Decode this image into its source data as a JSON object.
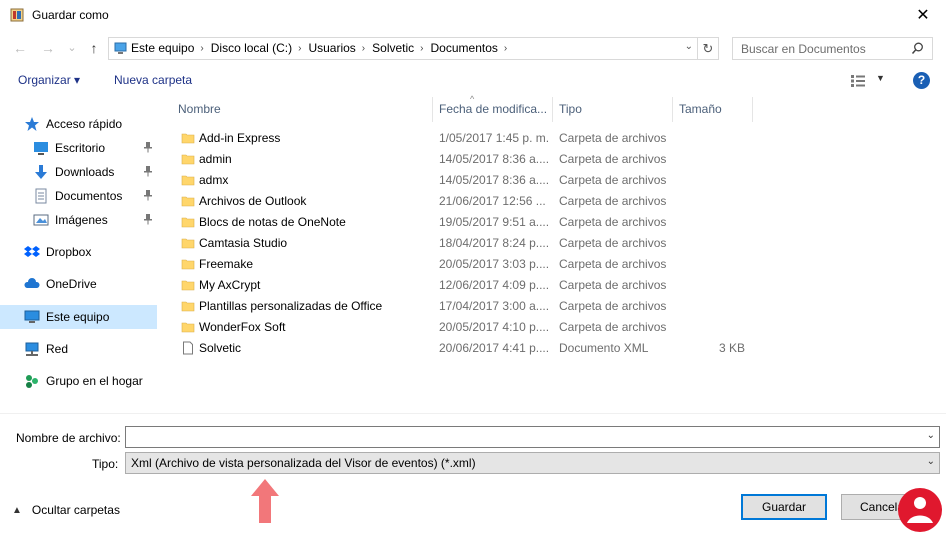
{
  "window": {
    "title": "Guardar como",
    "close_glyph": "✕"
  },
  "navigation": {
    "back_glyph": "←",
    "forward_glyph": "→",
    "recent_glyph": "⌄",
    "up_glyph": "↑",
    "breadcrumbs": [
      "Este equipo",
      "Disco local (C:)",
      "Usuarios",
      "Solvetic",
      "Documentos"
    ],
    "breadcrumb_separator": "›",
    "refresh_glyph": "↻",
    "search_placeholder": "Buscar en Documentos"
  },
  "toolbar": {
    "organize": "Organizar ▾",
    "new_folder": "Nueva carpeta",
    "help": "?"
  },
  "sidebar": {
    "items": [
      {
        "label": "Acceso rápido",
        "icon": "star-icon"
      },
      {
        "label": "Escritorio",
        "icon": "desktop-icon",
        "pinned": true
      },
      {
        "label": "Downloads",
        "icon": "download-icon",
        "pinned": true
      },
      {
        "label": "Documentos",
        "icon": "document-icon",
        "pinned": true
      },
      {
        "label": "Imágenes",
        "icon": "image-icon",
        "pinned": true
      },
      {
        "label": "Dropbox",
        "icon": "dropbox-icon"
      },
      {
        "label": "OneDrive",
        "icon": "cloud-icon"
      },
      {
        "label": "Este equipo",
        "icon": "computer-icon",
        "selected": true
      },
      {
        "label": "Red",
        "icon": "network-icon"
      },
      {
        "label": "Grupo en el hogar",
        "icon": "homegroup-icon"
      }
    ],
    "pin_glyph": "📌"
  },
  "columns": {
    "name": "Nombre",
    "date": "Fecha de modifica...",
    "type": "Tipo",
    "size": "Tamaño",
    "sort_glyph": "^"
  },
  "files": [
    {
      "name": "Add-in Express",
      "date": "1/05/2017 1:45 p. m.",
      "type": "Carpeta de archivos",
      "size": "",
      "kind": "folder"
    },
    {
      "name": "admin",
      "date": "14/05/2017 8:36 a....",
      "type": "Carpeta de archivos",
      "size": "",
      "kind": "folder"
    },
    {
      "name": "admx",
      "date": "14/05/2017 8:36 a....",
      "type": "Carpeta de archivos",
      "size": "",
      "kind": "folder"
    },
    {
      "name": "Archivos de Outlook",
      "date": "21/06/2017 12:56 ...",
      "type": "Carpeta de archivos",
      "size": "",
      "kind": "folder"
    },
    {
      "name": "Blocs de notas de OneNote",
      "date": "19/05/2017 9:51 a....",
      "type": "Carpeta de archivos",
      "size": "",
      "kind": "folder"
    },
    {
      "name": "Camtasia Studio",
      "date": "18/04/2017 8:24 p....",
      "type": "Carpeta de archivos",
      "size": "",
      "kind": "folder"
    },
    {
      "name": "Freemake",
      "date": "20/05/2017 3:03 p....",
      "type": "Carpeta de archivos",
      "size": "",
      "kind": "folder"
    },
    {
      "name": "My AxCrypt",
      "date": "12/06/2017 4:09 p....",
      "type": "Carpeta de archivos",
      "size": "",
      "kind": "folder"
    },
    {
      "name": "Plantillas personalizadas de Office",
      "date": "17/04/2017 3:00 a....",
      "type": "Carpeta de archivos",
      "size": "",
      "kind": "folder"
    },
    {
      "name": "WonderFox Soft",
      "date": "20/05/2017 4:10 p....",
      "type": "Carpeta de archivos",
      "size": "",
      "kind": "folder"
    },
    {
      "name": "Solvetic",
      "date": "20/06/2017 4:41 p....",
      "type": "Documento XML",
      "size": "3 KB",
      "kind": "file"
    }
  ],
  "form": {
    "filename_label": "Nombre de archivo:",
    "filename_value": "",
    "type_label": "Tipo:",
    "type_value": "Xml (Archivo de vista personalizada del Visor de eventos) (*.xml)",
    "dropdown_glyph": "⌄"
  },
  "footer": {
    "hide_folders": "Ocultar carpetas",
    "hide_glyph": "▲",
    "save": "Guardar",
    "cancel": "Cancelar"
  },
  "colors": {
    "accent": "#0078d7",
    "selection": "#cce8ff",
    "folder": "#ffd66b",
    "arrow": "#f2777a"
  }
}
